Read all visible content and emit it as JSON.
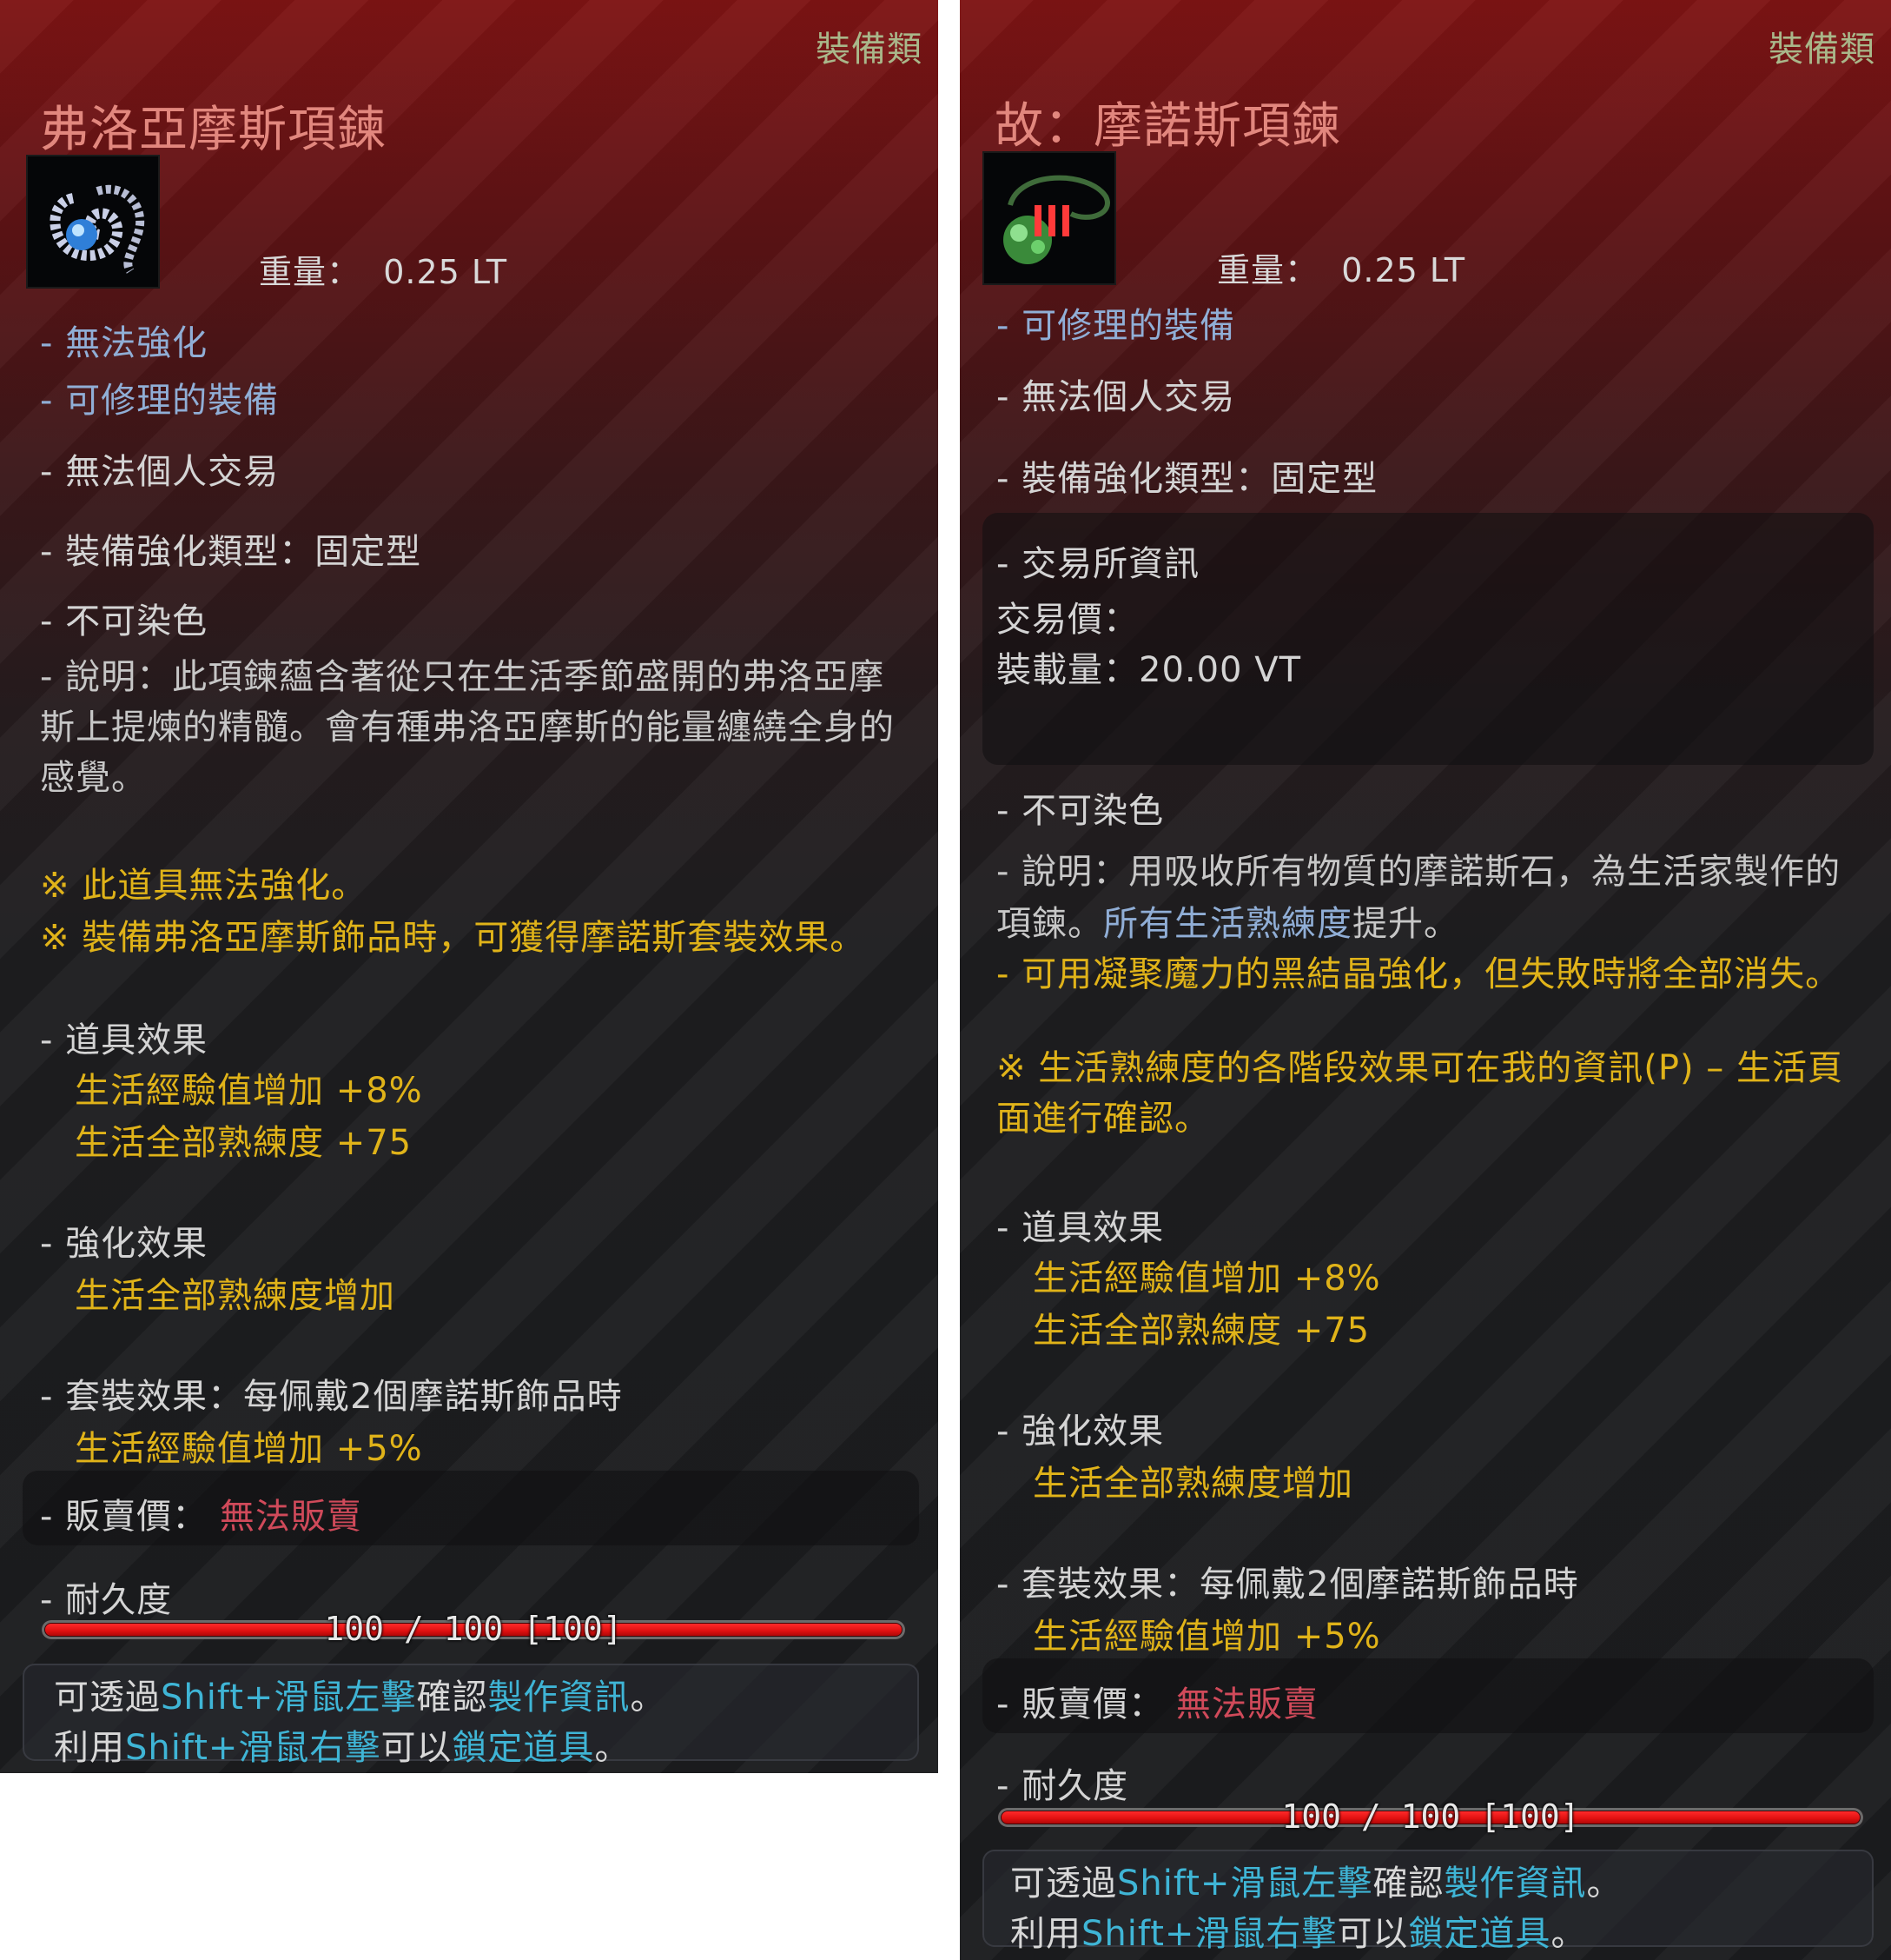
{
  "left": {
    "category": "裝備類",
    "title": "弗洛亞摩斯項鍊",
    "weight_label": "重量：",
    "weight_value": "0.25 LT",
    "properties": [
      "- 無法強化",
      "- 可修理的裝備",
      "- 無法個人交易",
      "- 裝備強化類型：固定型",
      "- 不可染色"
    ],
    "description": "- 說明：此項鍊蘊含著從只在生活季節盛開的弗洛亞摩斯上提煉的精髓。會有種弗洛亞摩斯的能量纏繞全身的感覺。",
    "notes": [
      "※ 此道具無法強化。",
      "※ 裝備弗洛亞摩斯飾品時，可獲得摩諾斯套裝效果。"
    ],
    "item_effect_header": "- 道具效果",
    "item_effects": [
      "生活經驗值增加 +8%",
      "生活全部熟練度 +75"
    ],
    "enhance_header": "- 強化效果",
    "enhance_effect": "生活全部熟練度增加",
    "set_header": "- 套裝效果：每佩戴2個摩諾斯飾品時",
    "set_effect": "生活經驗值增加 +5%",
    "sell_label": "- 販賣價：",
    "sell_value": "無法販賣",
    "durability_label": "- 耐久度",
    "durability_text": "100 / 100 [100]",
    "durability_fraction": 1.0,
    "footer": {
      "line1": [
        "可透過",
        "Shift+滑鼠左擊",
        "確認",
        "製作資訊",
        "。"
      ],
      "line2": [
        "利用",
        "Shift+滑鼠右擊",
        "可以",
        "鎖定道具",
        "。"
      ]
    }
  },
  "right": {
    "category": "裝備類",
    "title": "故：摩諾斯項鍊",
    "weight_label": "重量：",
    "weight_value": "0.25 LT",
    "properties": [
      "- 可修理的裝備",
      "- 無法個人交易",
      "- 裝備強化類型：固定型"
    ],
    "market_header": "- 交易所資訊",
    "market_price_label": "交易價：",
    "market_volume": "裝載量：20.00 VT",
    "no_dye": "- 不可染色",
    "description_a": "- 說明：用吸收所有物質的摩諾斯石，為生活家製作的",
    "description_b1": "項鍊。",
    "description_b2": "所有生活熟練度",
    "description_b3": "提升。",
    "enhance_note": "- 可用凝聚魔力的黑結晶強化，但失敗時將全部消失。",
    "note": "※ 生活熟練度的各階段效果可在我的資訊(P) – 生活頁面進行確認。",
    "item_effect_header": "- 道具效果",
    "item_effects": [
      "生活經驗值增加 +8%",
      "生活全部熟練度 +75"
    ],
    "enhance_header": "- 強化效果",
    "enhance_effect": "生活全部熟練度增加",
    "set_header": "- 套裝效果：每佩戴2個摩諾斯飾品時",
    "set_effect": "生活經驗值增加 +5%",
    "sell_label": "- 販賣價：",
    "sell_value": "無法販賣",
    "durability_label": "- 耐久度",
    "durability_text": "100 / 100 [100]",
    "durability_fraction": 1.0,
    "footer": {
      "line1": [
        "可透過",
        "Shift+滑鼠左擊",
        "確認",
        "製作資訊",
        "。"
      ],
      "line2": [
        "利用",
        "Shift+滑鼠右擊",
        "可以",
        "鎖定道具",
        "。"
      ]
    }
  },
  "colors": {
    "title": "#e2877e",
    "blue_text": "#90aed6",
    "yellow_text": "#e0b319",
    "red_text": "#d04a5a",
    "cyan_text": "#3fb5d6",
    "durability_bar": "#e01010"
  }
}
